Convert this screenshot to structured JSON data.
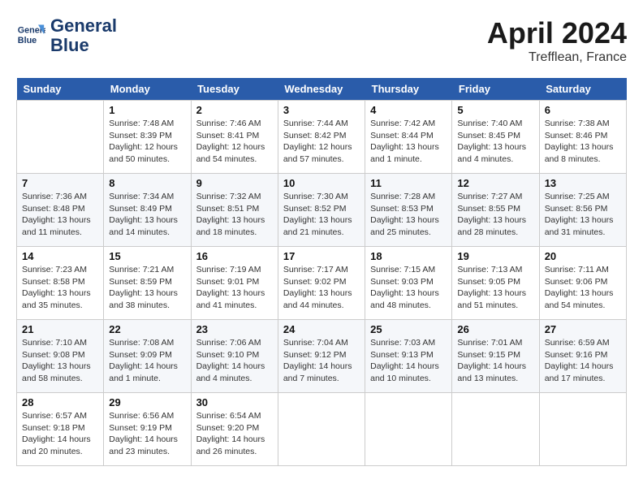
{
  "header": {
    "logo_line1": "General",
    "logo_line2": "Blue",
    "month": "April 2024",
    "location": "Trefflean, France"
  },
  "columns": [
    "Sunday",
    "Monday",
    "Tuesday",
    "Wednesday",
    "Thursday",
    "Friday",
    "Saturday"
  ],
  "weeks": [
    [
      {
        "day": "",
        "sunrise": "",
        "sunset": "",
        "daylight": ""
      },
      {
        "day": "1",
        "sunrise": "Sunrise: 7:48 AM",
        "sunset": "Sunset: 8:39 PM",
        "daylight": "Daylight: 12 hours and 50 minutes."
      },
      {
        "day": "2",
        "sunrise": "Sunrise: 7:46 AM",
        "sunset": "Sunset: 8:41 PM",
        "daylight": "Daylight: 12 hours and 54 minutes."
      },
      {
        "day": "3",
        "sunrise": "Sunrise: 7:44 AM",
        "sunset": "Sunset: 8:42 PM",
        "daylight": "Daylight: 12 hours and 57 minutes."
      },
      {
        "day": "4",
        "sunrise": "Sunrise: 7:42 AM",
        "sunset": "Sunset: 8:44 PM",
        "daylight": "Daylight: 13 hours and 1 minute."
      },
      {
        "day": "5",
        "sunrise": "Sunrise: 7:40 AM",
        "sunset": "Sunset: 8:45 PM",
        "daylight": "Daylight: 13 hours and 4 minutes."
      },
      {
        "day": "6",
        "sunrise": "Sunrise: 7:38 AM",
        "sunset": "Sunset: 8:46 PM",
        "daylight": "Daylight: 13 hours and 8 minutes."
      }
    ],
    [
      {
        "day": "7",
        "sunrise": "Sunrise: 7:36 AM",
        "sunset": "Sunset: 8:48 PM",
        "daylight": "Daylight: 13 hours and 11 minutes."
      },
      {
        "day": "8",
        "sunrise": "Sunrise: 7:34 AM",
        "sunset": "Sunset: 8:49 PM",
        "daylight": "Daylight: 13 hours and 14 minutes."
      },
      {
        "day": "9",
        "sunrise": "Sunrise: 7:32 AM",
        "sunset": "Sunset: 8:51 PM",
        "daylight": "Daylight: 13 hours and 18 minutes."
      },
      {
        "day": "10",
        "sunrise": "Sunrise: 7:30 AM",
        "sunset": "Sunset: 8:52 PM",
        "daylight": "Daylight: 13 hours and 21 minutes."
      },
      {
        "day": "11",
        "sunrise": "Sunrise: 7:28 AM",
        "sunset": "Sunset: 8:53 PM",
        "daylight": "Daylight: 13 hours and 25 minutes."
      },
      {
        "day": "12",
        "sunrise": "Sunrise: 7:27 AM",
        "sunset": "Sunset: 8:55 PM",
        "daylight": "Daylight: 13 hours and 28 minutes."
      },
      {
        "day": "13",
        "sunrise": "Sunrise: 7:25 AM",
        "sunset": "Sunset: 8:56 PM",
        "daylight": "Daylight: 13 hours and 31 minutes."
      }
    ],
    [
      {
        "day": "14",
        "sunrise": "Sunrise: 7:23 AM",
        "sunset": "Sunset: 8:58 PM",
        "daylight": "Daylight: 13 hours and 35 minutes."
      },
      {
        "day": "15",
        "sunrise": "Sunrise: 7:21 AM",
        "sunset": "Sunset: 8:59 PM",
        "daylight": "Daylight: 13 hours and 38 minutes."
      },
      {
        "day": "16",
        "sunrise": "Sunrise: 7:19 AM",
        "sunset": "Sunset: 9:01 PM",
        "daylight": "Daylight: 13 hours and 41 minutes."
      },
      {
        "day": "17",
        "sunrise": "Sunrise: 7:17 AM",
        "sunset": "Sunset: 9:02 PM",
        "daylight": "Daylight: 13 hours and 44 minutes."
      },
      {
        "day": "18",
        "sunrise": "Sunrise: 7:15 AM",
        "sunset": "Sunset: 9:03 PM",
        "daylight": "Daylight: 13 hours and 48 minutes."
      },
      {
        "day": "19",
        "sunrise": "Sunrise: 7:13 AM",
        "sunset": "Sunset: 9:05 PM",
        "daylight": "Daylight: 13 hours and 51 minutes."
      },
      {
        "day": "20",
        "sunrise": "Sunrise: 7:11 AM",
        "sunset": "Sunset: 9:06 PM",
        "daylight": "Daylight: 13 hours and 54 minutes."
      }
    ],
    [
      {
        "day": "21",
        "sunrise": "Sunrise: 7:10 AM",
        "sunset": "Sunset: 9:08 PM",
        "daylight": "Daylight: 13 hours and 58 minutes."
      },
      {
        "day": "22",
        "sunrise": "Sunrise: 7:08 AM",
        "sunset": "Sunset: 9:09 PM",
        "daylight": "Daylight: 14 hours and 1 minute."
      },
      {
        "day": "23",
        "sunrise": "Sunrise: 7:06 AM",
        "sunset": "Sunset: 9:10 PM",
        "daylight": "Daylight: 14 hours and 4 minutes."
      },
      {
        "day": "24",
        "sunrise": "Sunrise: 7:04 AM",
        "sunset": "Sunset: 9:12 PM",
        "daylight": "Daylight: 14 hours and 7 minutes."
      },
      {
        "day": "25",
        "sunrise": "Sunrise: 7:03 AM",
        "sunset": "Sunset: 9:13 PM",
        "daylight": "Daylight: 14 hours and 10 minutes."
      },
      {
        "day": "26",
        "sunrise": "Sunrise: 7:01 AM",
        "sunset": "Sunset: 9:15 PM",
        "daylight": "Daylight: 14 hours and 13 minutes."
      },
      {
        "day": "27",
        "sunrise": "Sunrise: 6:59 AM",
        "sunset": "Sunset: 9:16 PM",
        "daylight": "Daylight: 14 hours and 17 minutes."
      }
    ],
    [
      {
        "day": "28",
        "sunrise": "Sunrise: 6:57 AM",
        "sunset": "Sunset: 9:18 PM",
        "daylight": "Daylight: 14 hours and 20 minutes."
      },
      {
        "day": "29",
        "sunrise": "Sunrise: 6:56 AM",
        "sunset": "Sunset: 9:19 PM",
        "daylight": "Daylight: 14 hours and 23 minutes."
      },
      {
        "day": "30",
        "sunrise": "Sunrise: 6:54 AM",
        "sunset": "Sunset: 9:20 PM",
        "daylight": "Daylight: 14 hours and 26 minutes."
      },
      {
        "day": "",
        "sunrise": "",
        "sunset": "",
        "daylight": ""
      },
      {
        "day": "",
        "sunrise": "",
        "sunset": "",
        "daylight": ""
      },
      {
        "day": "",
        "sunrise": "",
        "sunset": "",
        "daylight": ""
      },
      {
        "day": "",
        "sunrise": "",
        "sunset": "",
        "daylight": ""
      }
    ]
  ]
}
